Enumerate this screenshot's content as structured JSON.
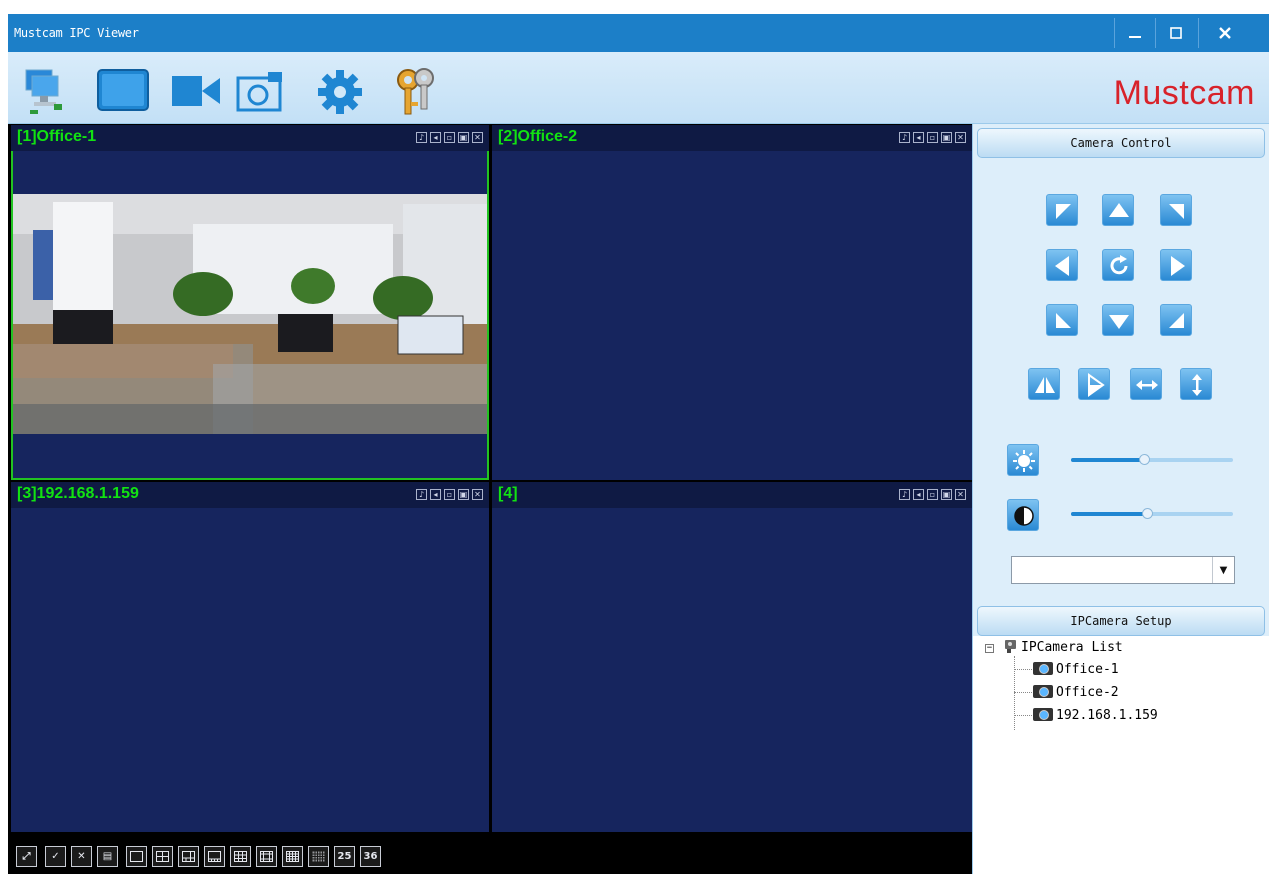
{
  "window": {
    "title": "Mustcam IPC Viewer",
    "minimize_label": "–",
    "maximize_label": "□",
    "close_label": "✕"
  },
  "toolbar": {
    "brand": "Mustcam",
    "icons": [
      "device-manager-icon",
      "monitor-icon",
      "record-icon",
      "snapshot-icon",
      "settings-icon",
      "keys-icon"
    ]
  },
  "panes": [
    {
      "label": "[1]Office-1",
      "selected": true,
      "has_video": true
    },
    {
      "label": "[2]Office-2",
      "selected": false,
      "has_video": false
    },
    {
      "label": "[3]192.168.1.159",
      "selected": false,
      "has_video": false
    },
    {
      "label": "[4]",
      "selected": false,
      "has_video": false
    }
  ],
  "bottom_bar": {
    "buttons": [
      "fullscreen",
      "select-all",
      "close-all",
      "cycle",
      "1-split",
      "4-split",
      "6-split",
      "8-split",
      "9-split",
      "13-split",
      "16-split",
      "20-split",
      "25",
      "36"
    ],
    "labels": {
      "split25": "25",
      "split36": "36"
    }
  },
  "camera_control": {
    "header": "Camera Control",
    "brightness": 0.45,
    "contrast": 0.47,
    "preset_value": ""
  },
  "setup": {
    "header": "IPCamera Setup",
    "root": "IPCamera List",
    "cameras": [
      "Office-1",
      "Office-2",
      "192.168.1.159"
    ]
  },
  "colors": {
    "titlebar": "#1c7fc8",
    "pane_bg": "#16255e",
    "label_green": "#12e212",
    "brand_red": "#d8222a"
  }
}
